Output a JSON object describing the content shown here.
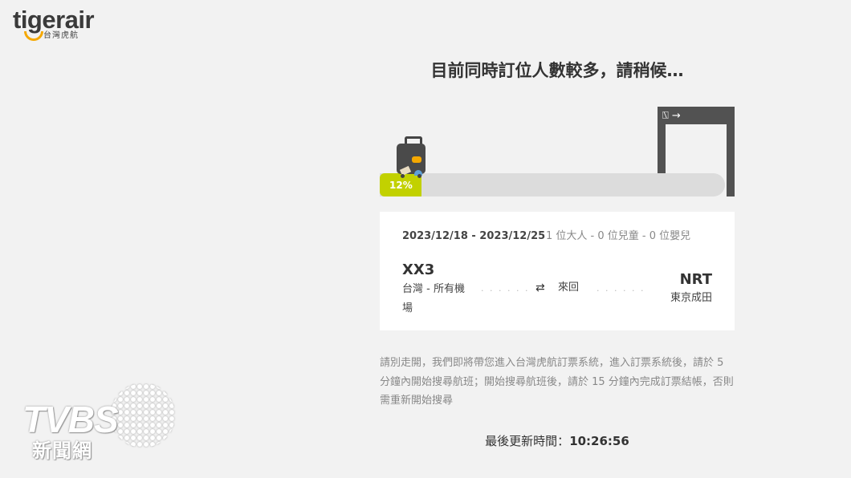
{
  "brand": {
    "name": "tigerair",
    "sub": "台灣虎航",
    "accent": "#f5a800",
    "progress_color": "#c2d100"
  },
  "heading": "目前同時訂位人數較多，請稍候…",
  "progress": {
    "value": 12,
    "label": "12%"
  },
  "gate": {
    "sign": "⍂ →"
  },
  "booking": {
    "dates": "2023/12/18 - 2023/12/25",
    "passengers": "1 位大人 - 0 位兒童 - 0 位嬰兒",
    "from": {
      "code": "XX3",
      "name": "台灣 - 所有機場"
    },
    "to": {
      "code": "NRT",
      "name": "東京成田"
    },
    "trip_type": "來回",
    "swap_icon": "⇄"
  },
  "notice": "請別走開，我們即將帶您進入台灣虎航訂票系統，進入訂票系統後，請於 5 分鐘內開始搜尋航班；開始搜尋航班後，請於 15 分鐘內完成訂票結帳，否則需重新開始搜尋",
  "last_updated": {
    "label": "最後更新時間：",
    "time": "10:26:56"
  },
  "watermark": {
    "name": "TVBS",
    "sub": "新聞網"
  }
}
